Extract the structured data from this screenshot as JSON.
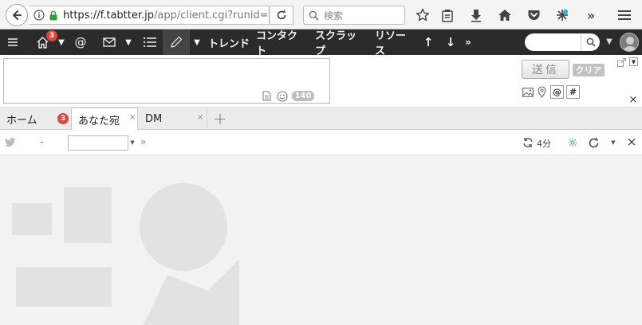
{
  "browser": {
    "url_host": "https://f.tabtter.jp",
    "url_path": "/app/client.cgi?runid=T",
    "search_placeholder": "検索"
  },
  "nav": {
    "home_badge": "3",
    "at_label": "@",
    "trend_label": "トレンド",
    "contact_label": "コンタクト",
    "scrap_label": "スクラップ",
    "resource_label": "リソース",
    "up_label": "↑",
    "down_label": "↓",
    "more_label": "»",
    "search_value": ""
  },
  "compose": {
    "text": "",
    "char_count": "140",
    "send_label": "送信",
    "clear_label": "クリア",
    "at_button": "@",
    "hash_button": "#"
  },
  "tabs": [
    {
      "label": "ホーム",
      "badge": "3"
    },
    {
      "label": "あなた宛",
      "close": "×"
    },
    {
      "label": "DM",
      "close": "×"
    }
  ],
  "add_tab_label": "+",
  "column": {
    "dash": "-",
    "input_value": "",
    "more": "»",
    "refresh_interval": "4分",
    "close": "×"
  },
  "colors": {
    "nav_bg": "#2b2b2b",
    "badge": "#e0453c",
    "secure_lock": "#2aa236"
  }
}
